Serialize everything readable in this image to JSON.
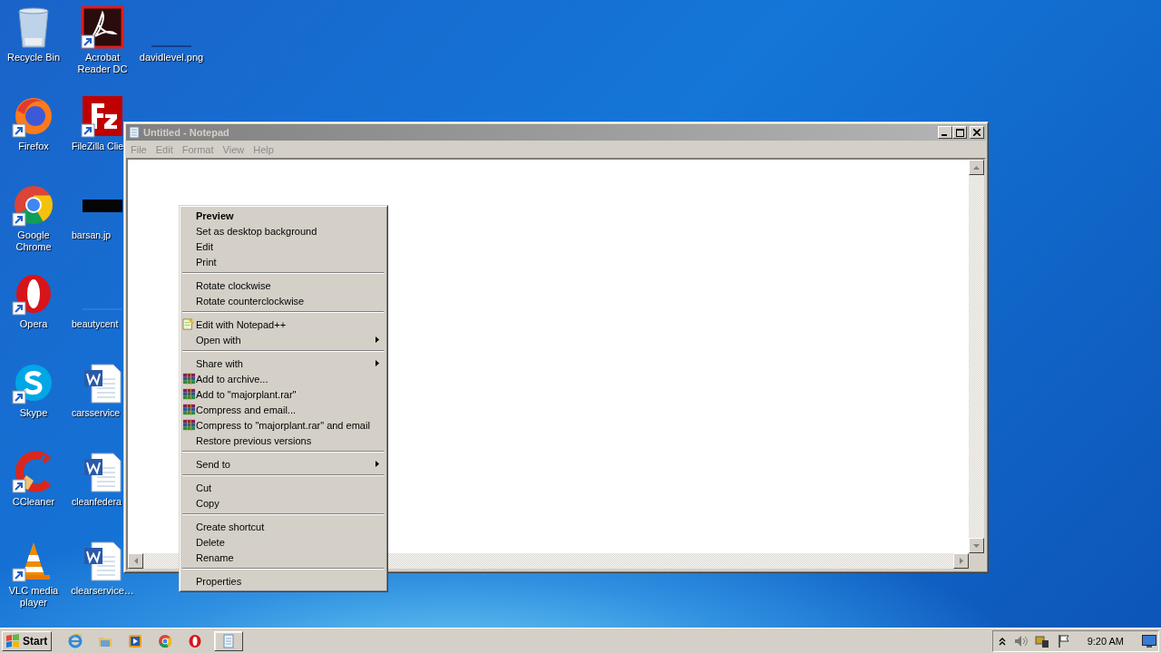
{
  "desktop": {
    "columns": [
      [
        {
          "label": "Recycle Bin",
          "shortcut": false,
          "clipped": false
        },
        {
          "label": "Firefox",
          "shortcut": true,
          "clipped": false
        },
        {
          "label": "Google Chrome",
          "shortcut": true,
          "clipped": false
        },
        {
          "label": "Opera",
          "shortcut": true,
          "clipped": false
        },
        {
          "label": "Skype",
          "shortcut": true,
          "clipped": false
        },
        {
          "label": "CCleaner",
          "shortcut": true,
          "clipped": false
        },
        {
          "label": "VLC media player",
          "shortcut": true,
          "clipped": false
        }
      ],
      [
        {
          "label": "Acrobat Reader DC",
          "shortcut": true,
          "clipped": false
        },
        {
          "label": "FileZilla Clie",
          "shortcut": true,
          "clipped": true
        },
        {
          "label": "barsan.jp",
          "shortcut": false,
          "clipped": true
        },
        {
          "label": "beautycent",
          "shortcut": false,
          "clipped": true
        },
        {
          "label": "carsservice",
          "shortcut": false,
          "clipped": true
        },
        {
          "label": "cleanfedera",
          "shortcut": false,
          "clipped": true
        },
        {
          "label": "clearservice…",
          "shortcut": false,
          "clipped": false
        }
      ],
      [
        {
          "label": "davidlevel.png",
          "shortcut": false,
          "clipped": false
        }
      ]
    ]
  },
  "notepad": {
    "title": "Untitled - Notepad",
    "active": false,
    "menu": [
      "File",
      "Edit",
      "Format",
      "View",
      "Help"
    ]
  },
  "context_menu": {
    "groups": [
      [
        {
          "label": "Preview",
          "default": true,
          "kind": "plain",
          "submenu": false
        },
        {
          "label": "Set as desktop background",
          "default": false,
          "kind": "plain",
          "submenu": false
        },
        {
          "label": "Edit",
          "default": false,
          "kind": "plain",
          "submenu": false
        },
        {
          "label": "Print",
          "default": false,
          "kind": "plain",
          "submenu": false
        }
      ],
      [
        {
          "label": "Rotate clockwise",
          "default": false,
          "kind": "plain",
          "submenu": false
        },
        {
          "label": "Rotate counterclockwise",
          "default": false,
          "kind": "plain",
          "submenu": false
        }
      ],
      [
        {
          "label": "Edit with Notepad++",
          "default": false,
          "kind": "notepad",
          "submenu": false
        },
        {
          "label": "Open with",
          "default": false,
          "kind": "plain",
          "submenu": true
        }
      ],
      [
        {
          "label": "Share with",
          "default": false,
          "kind": "plain",
          "submenu": true
        },
        {
          "label": "Add to archive...",
          "default": false,
          "kind": "archive",
          "submenu": false
        },
        {
          "label": "Add to \"majorplant.rar\"",
          "default": false,
          "kind": "archive",
          "submenu": false
        },
        {
          "label": "Compress and email...",
          "default": false,
          "kind": "archive",
          "submenu": false
        },
        {
          "label": "Compress to \"majorplant.rar\" and email",
          "default": false,
          "kind": "archive",
          "submenu": false
        },
        {
          "label": "Restore previous versions",
          "default": false,
          "kind": "plain",
          "submenu": false
        }
      ],
      [
        {
          "label": "Send to",
          "default": false,
          "kind": "plain",
          "submenu": true
        }
      ],
      [
        {
          "label": "Cut",
          "default": false,
          "kind": "plain",
          "submenu": false
        },
        {
          "label": "Copy",
          "default": false,
          "kind": "plain",
          "submenu": false
        }
      ],
      [
        {
          "label": "Create shortcut",
          "default": false,
          "kind": "plain",
          "submenu": false
        },
        {
          "label": "Delete",
          "default": false,
          "kind": "plain",
          "submenu": false
        },
        {
          "label": "Rename",
          "default": false,
          "kind": "plain",
          "submenu": false
        }
      ],
      [
        {
          "label": "Properties",
          "default": false,
          "kind": "plain",
          "submenu": false
        }
      ]
    ]
  },
  "taskbar": {
    "start": "Start",
    "apps": [
      {
        "running": false
      },
      {
        "running": false
      },
      {
        "running": false
      },
      {
        "running": false
      },
      {
        "running": false
      },
      {
        "running": true
      }
    ],
    "clock": "9:20 AM"
  }
}
